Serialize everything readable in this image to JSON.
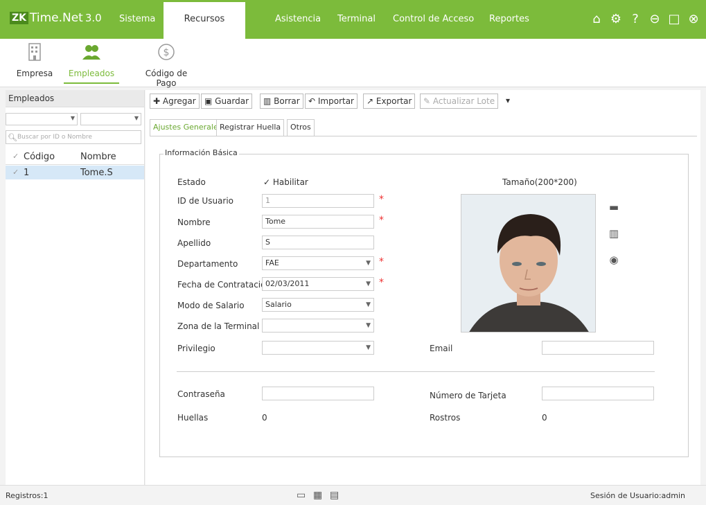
{
  "app": {
    "logo_badge": "ZK",
    "brand": "Time.Net",
    "version": "3.0"
  },
  "menu": [
    "Sistema",
    "Recursos Humanos",
    "Asistencia",
    "Terminal",
    "Control de Acceso",
    "Reportes"
  ],
  "active_menu": "Recursos Humanos",
  "window_icons": [
    "home-icon",
    "settings-icon",
    "help-icon",
    "minimize-icon",
    "maximize-icon",
    "close-icon"
  ],
  "submenu": [
    {
      "label": "Empresa",
      "icon": "building-icon"
    },
    {
      "label": "Empleados",
      "icon": "people-icon"
    },
    {
      "label": "Código de Pago",
      "icon": "dollar-icon"
    }
  ],
  "left_panel": {
    "title": "Empleados",
    "search_placeholder": "Buscar por ID o Nombre",
    "columns": [
      "Código",
      "Nombre"
    ],
    "rows": [
      {
        "code": "1",
        "name": "Tome.S"
      }
    ]
  },
  "toolbar": [
    "Agregar",
    "Guardar",
    "Borrar",
    "Importar",
    "Exportar",
    "Actualizar Lote"
  ],
  "tabs": [
    "Ajustes Generales",
    "Registrar Huella",
    "Otros"
  ],
  "form": {
    "section": "Información Básica",
    "estado_label": "Estado",
    "habilitar_label": "Habilitar",
    "habilitar_checked": true,
    "user_id_label": "ID de Usuario",
    "user_id_value": "1",
    "nombre_label": "Nombre",
    "nombre_value": "Tome",
    "apellido_label": "Apellido",
    "apellido_value": "S",
    "departamento_label": "Departamento",
    "departamento_value": "FAE",
    "fecha_label": "Fecha de Contratación",
    "fecha_value": "02/03/2011",
    "salario_label": "Modo de Salario",
    "salario_value": "Salario",
    "zona_label": "Zona de la Terminal",
    "zona_value": "",
    "privilegio_label": "Privilegio",
    "privilegio_value": "",
    "email_label": "Email",
    "email_value": "",
    "photo_size_label": "Tamaño(200*200)",
    "contrasena_label": "Contraseña",
    "contrasena_value": "",
    "tarjeta_label": "Número de Tarjeta",
    "tarjeta_value": "",
    "huellas_label": "Huellas",
    "huellas_value": "0",
    "rostros_label": "Rostros",
    "rostros_value": "0"
  },
  "status": {
    "registros": "Registros:1",
    "session": "Sesión de Usuario:admin"
  }
}
